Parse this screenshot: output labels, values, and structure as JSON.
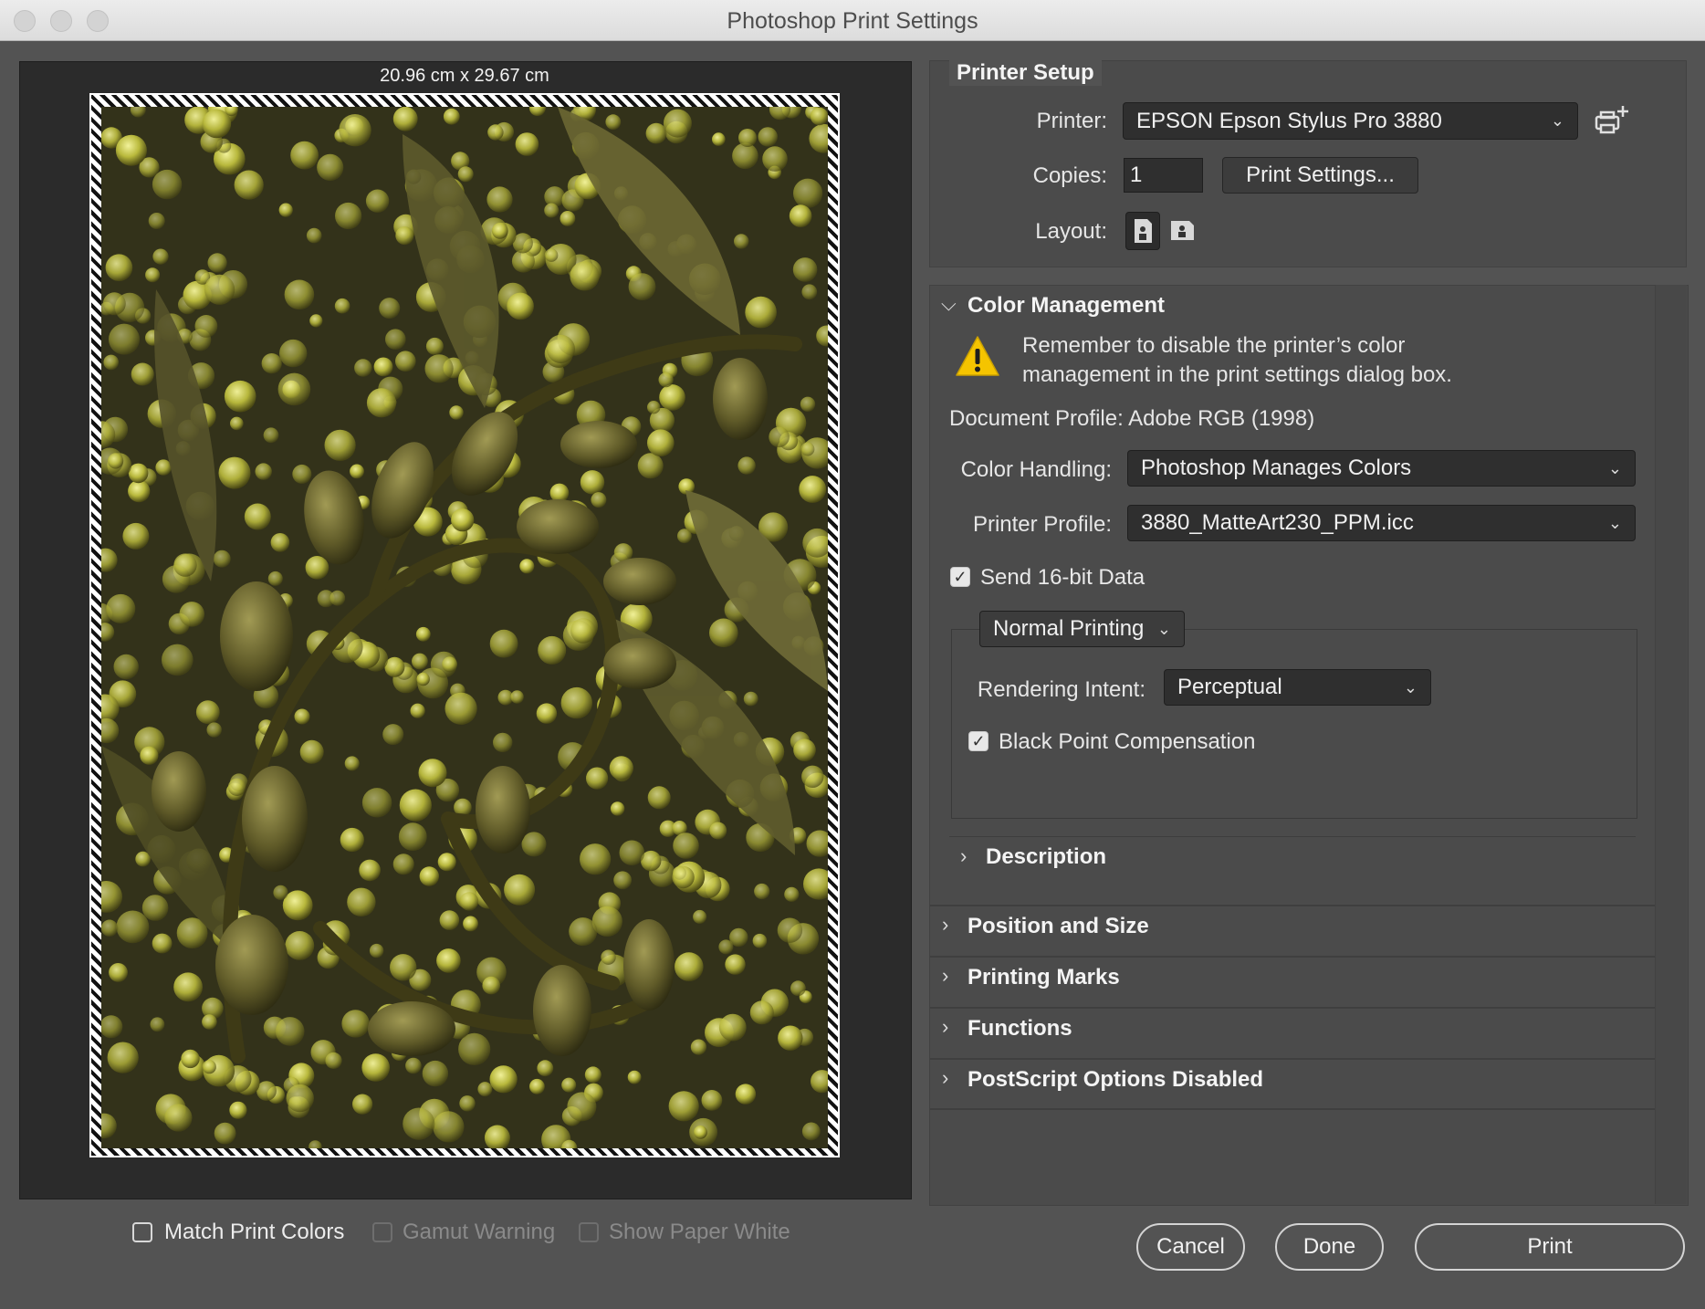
{
  "window": {
    "title": "Photoshop Print Settings"
  },
  "preview": {
    "dimensions": "20.96 cm x 29.67 cm"
  },
  "printer_setup": {
    "heading": "Printer Setup",
    "printer_label": "Printer:",
    "printer_value": "EPSON Epson Stylus Pro 3880",
    "copies_label": "Copies:",
    "copies_value": "1",
    "print_settings_button": "Print Settings...",
    "layout_label": "Layout:"
  },
  "color_management": {
    "heading": "Color Management",
    "warning_line1": "Remember to disable the printer’s color",
    "warning_line2": "management in the print settings dialog box.",
    "document_profile": "Document Profile: Adobe RGB (1998)",
    "color_handling_label": "Color Handling:",
    "color_handling_value": "Photoshop Manages Colors",
    "printer_profile_label": "Printer Profile:",
    "printer_profile_value": "3880_MatteArt230_PPM.icc",
    "send_16bit_label": "Send 16-bit Data",
    "send_16bit_checked": true,
    "normal_printing": "Normal Printing",
    "rendering_intent_label": "Rendering Intent:",
    "rendering_intent_value": "Perceptual",
    "bpc_label": "Black Point Compensation",
    "bpc_checked": true,
    "description_label": "Description"
  },
  "sections": {
    "position_size": "Position and Size",
    "printing_marks": "Printing Marks",
    "functions": "Functions",
    "postscript": "PostScript Options Disabled"
  },
  "bottom": {
    "match_print_colors": "Match Print Colors",
    "gamut_warning": "Gamut Warning",
    "show_paper_white": "Show Paper White",
    "cancel": "Cancel",
    "done": "Done",
    "print": "Print"
  },
  "colors": {
    "dialog_bg": "#535353",
    "preview_bg": "#2b2b2b",
    "warning_yellow": "#f5c400"
  }
}
